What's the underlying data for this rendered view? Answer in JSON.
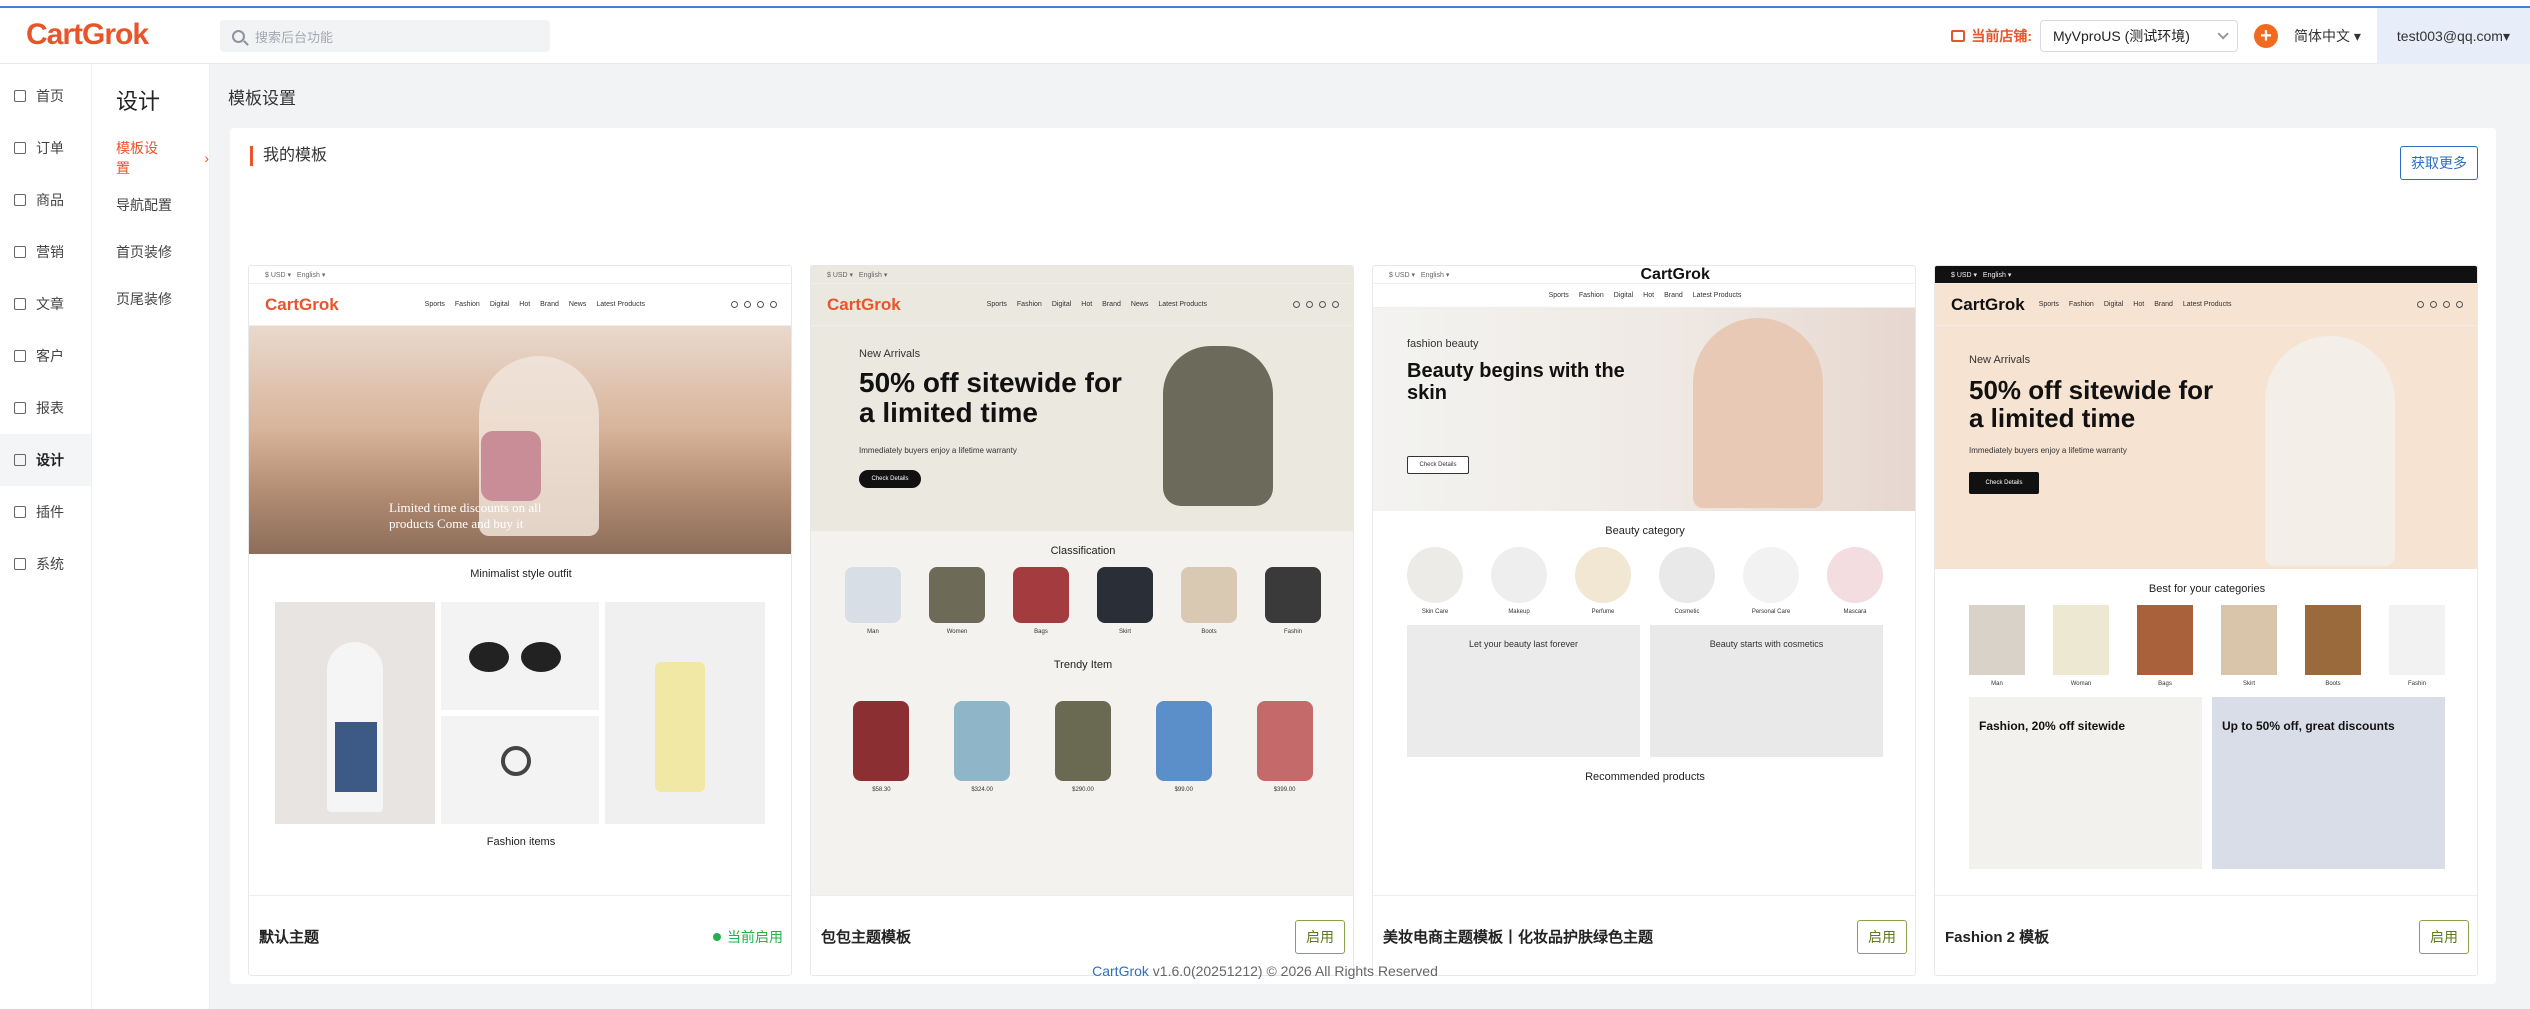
{
  "header": {
    "logo": "CartGrok",
    "search_placeholder": "搜索后台功能",
    "store_label": "当前店铺:",
    "store_value": "MyVproUS (测试环境)",
    "lang": "简体中文",
    "user": "test003@qq.com"
  },
  "left_nav": [
    "首页",
    "订单",
    "商品",
    "营销",
    "文章",
    "客户",
    "报表",
    "设计",
    "插件",
    "系统"
  ],
  "sub_nav": {
    "title": "设计",
    "items": [
      "模板设置",
      "导航配置",
      "首页装修",
      "页尾装修"
    ]
  },
  "page_title": "模板设置",
  "section_title": "我的模板",
  "get_more": "获取更多",
  "templates": [
    {
      "name": "默认主题",
      "status": "当前启用",
      "hero_text": "Limited time discounts on all products Come and buy it",
      "section": "Minimalist style outfit",
      "subsection": "Fashion items"
    },
    {
      "name": "包包主题模板",
      "button": "启用",
      "hero_kicker": "New Arrivals",
      "hero_title": "50% off sitewide for a limited time",
      "hero_sub": "Immediately buyers enjoy a lifetime warranty",
      "section": "Classification",
      "subsection": "Trendy Item"
    },
    {
      "name": "美妆电商主题模板丨化妆品护肤绿色主题",
      "button": "启用",
      "hero_kicker": "fashion beauty",
      "hero_title": "Beauty begins with the skin",
      "section": "Beauty category",
      "subsection": "Recommended products"
    },
    {
      "name": "Fashion 2 模板",
      "button": "启用",
      "hero_kicker": "New Arrivals",
      "hero_title": "50% off sitewide for a limited time",
      "hero_sub": "Immediately buyers enjoy a lifetime warranty",
      "section": "Best for your categories",
      "promo1": "Fashion, 20% off sitewide",
      "promo2": "Up to 50% off, great discounts"
    }
  ],
  "footer": {
    "brand": "CartGrok",
    "rest": " v1.6.0(20251212) © 2026 All Rights Reserved"
  }
}
